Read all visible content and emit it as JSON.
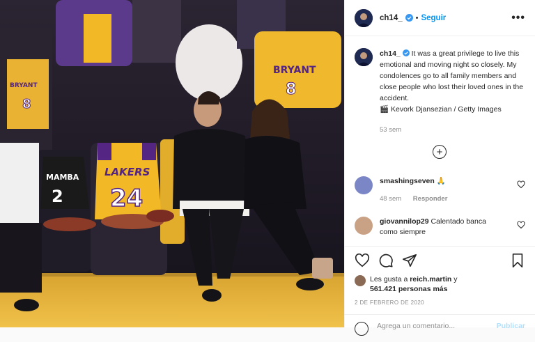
{
  "post": {
    "username": "ch14_",
    "dot": "•",
    "follow_label": "Seguir",
    "more_icon": "more-horizontal-icon"
  },
  "caption": {
    "username": "ch14_",
    "text": "It was a great privilege to live this emotional and moving night so closely. My condolences go to all family members and close people who lost their loved ones in the accident.",
    "credit": "Kevork Djansezian / Getty Images",
    "credit_icon": "clapper-icon",
    "time": "53 sem"
  },
  "comments": [
    {
      "username": "smashingseven",
      "text": "",
      "emoji": "🙏",
      "time": "48 sem",
      "reply_label": "Responder"
    },
    {
      "username": "giovannilop29",
      "text": "Calentado banca como siempre",
      "time": "",
      "reply_label": ""
    }
  ],
  "likes": {
    "prefix": "Les gusta a",
    "user": "reich.martin",
    "joiner": "y",
    "count_text": "561.421 personas más"
  },
  "date": "2 de febrero de 2020",
  "add_comment": {
    "placeholder": "Agrega un comentario...",
    "publish_label": "Publicar"
  },
  "photo": {
    "jersey_left_name": "MAMBA",
    "jersey_left_number": "2",
    "jersey_center_brand": "LAKERS",
    "jersey_center_number": "24",
    "jersey_back_name": "BRYANT",
    "jersey_back_number": "8",
    "jersey_left_fan": "BRYANT",
    "jersey_left_fan_number": "8"
  },
  "colors": {
    "accent": "#0095f6",
    "lakers_gold": "#f2b826",
    "lakers_purple": "#552583",
    "court": "#e8b93c"
  }
}
